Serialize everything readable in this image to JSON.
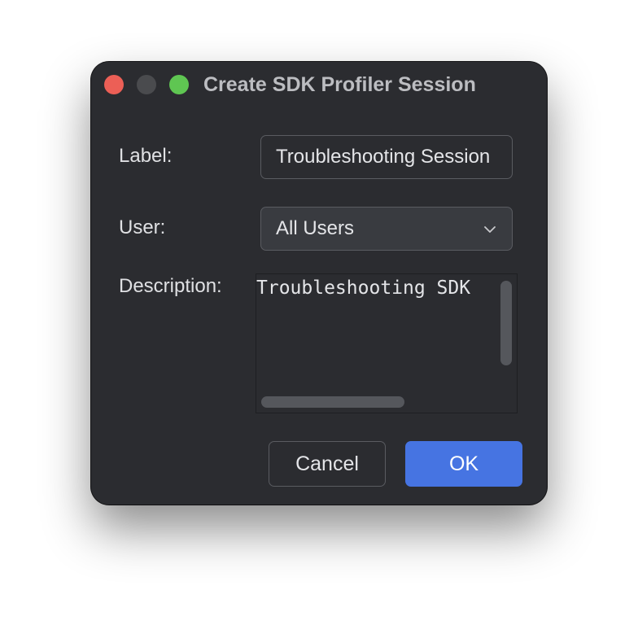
{
  "window": {
    "title": "Create SDK Profiler Session"
  },
  "form": {
    "label_caption": "Label:",
    "label_value": "Troubleshooting Session",
    "user_caption": "User:",
    "user_selected": "All Users",
    "description_caption": "Description:",
    "description_value": "Troubleshooting SDK"
  },
  "buttons": {
    "cancel": "Cancel",
    "ok": "OK"
  },
  "icons": {
    "close": "close-traffic-light",
    "minimize": "minimize-traffic-light",
    "maximize": "maximize-traffic-light",
    "dropdown": "chevron-down-icon"
  },
  "colors": {
    "window_bg": "#2b2c30",
    "accent": "#4674e2",
    "close": "#ec5f56",
    "maximize": "#5fc652"
  }
}
